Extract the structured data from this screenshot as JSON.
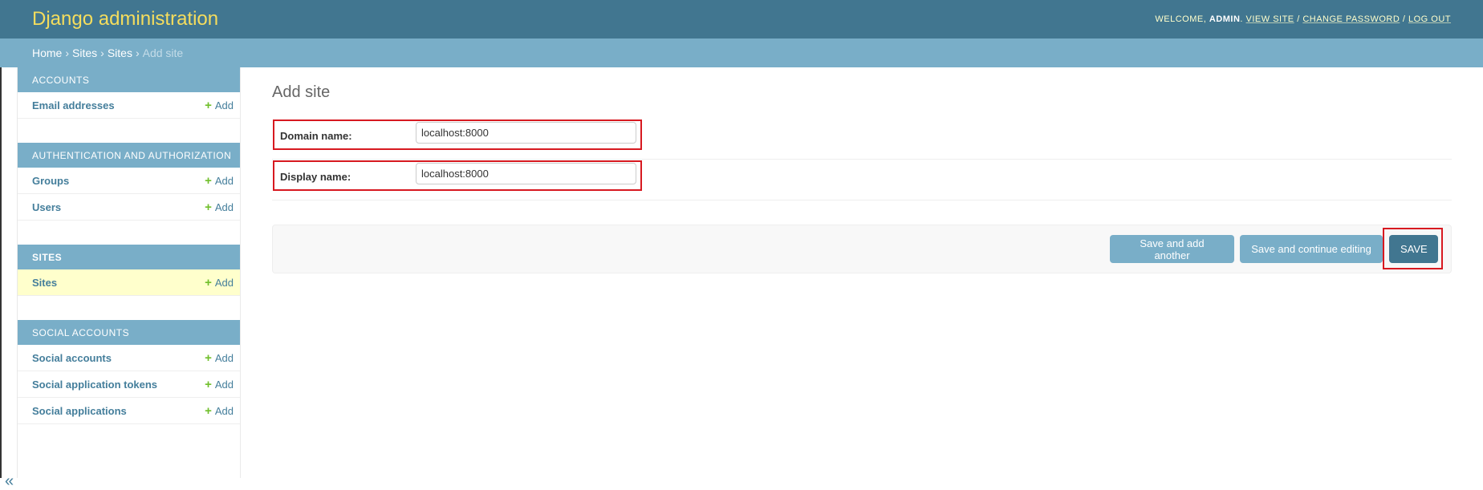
{
  "header": {
    "brand": "Django administration",
    "welcome": "Welcome, ",
    "username": "admin",
    "links": {
      "view_site": "View site",
      "change_password": "Change password",
      "log_out": "Log out"
    }
  },
  "breadcrumbs": {
    "home": "Home",
    "app": "Sites",
    "model": "Sites",
    "current": "Add site",
    "separator": "›"
  },
  "sidebar": {
    "toggle_label": "«",
    "modules": [
      {
        "caption": "Accounts",
        "rows": [
          {
            "name": "Email addresses",
            "add": "Add"
          }
        ]
      },
      {
        "caption": "Authentication and Authorization",
        "rows": [
          {
            "name": "Groups",
            "add": "Add"
          },
          {
            "name": "Users",
            "add": "Add"
          }
        ]
      },
      {
        "caption": "Sites",
        "rows": [
          {
            "name": "Sites",
            "add": "Add"
          }
        ]
      },
      {
        "caption": "Social Accounts",
        "rows": [
          {
            "name": "Social accounts",
            "add": "Add"
          },
          {
            "name": "Social application tokens",
            "add": "Add"
          },
          {
            "name": "Social applications",
            "add": "Add"
          }
        ]
      }
    ]
  },
  "main": {
    "title": "Add site",
    "fields": {
      "domain": {
        "label": "Domain name:",
        "value": "localhost:8000"
      },
      "display": {
        "label": "Display name:",
        "value": "localhost:8000"
      }
    },
    "buttons": {
      "save_add_another": "Save and add another",
      "save_continue": "Save and continue editing",
      "save": "SAVE"
    }
  },
  "colors": {
    "header_bg": "#417690",
    "breadcrumb_bg": "#79aec8",
    "brand_text": "#f5dd5d",
    "link": "#447e9b",
    "add_icon": "#70bf2b",
    "current_row_bg": "#ffffcc",
    "highlight_border": "#d71920"
  }
}
